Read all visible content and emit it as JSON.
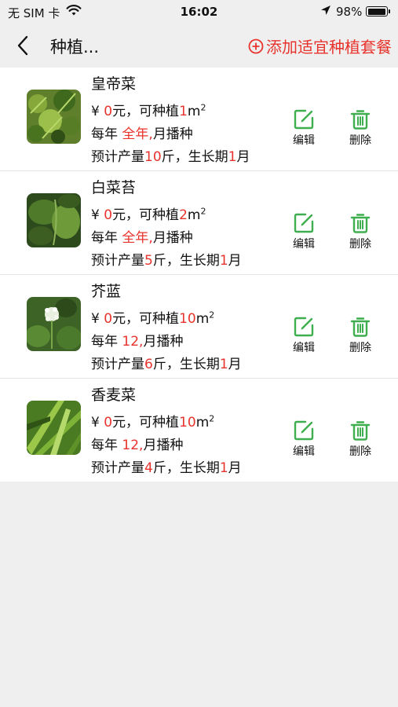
{
  "status": {
    "carrier": "无 SIM 卡",
    "time": "16:02",
    "battery_pct": "98%",
    "battery_level": 0.98
  },
  "nav": {
    "title": "种植...",
    "add_label": "添加适宜种植套餐"
  },
  "labels": {
    "currency": "¥",
    "yuan_plant": "元，可种植",
    "unit_m": "m",
    "sq": "2",
    "yearly": "每年",
    "month_sow": "月播种",
    "est_yield": "预计产量",
    "jin_period": "斤，生长期",
    "month": "月",
    "edit": "编辑",
    "delete": "删除"
  },
  "items": [
    {
      "name": "皇帝菜",
      "price": "0",
      "area": "1",
      "season": "全年,",
      "yield": "10",
      "period": "1"
    },
    {
      "name": "白菜苔",
      "price": "0",
      "area": "2",
      "season": "全年,",
      "yield": "5",
      "period": "1"
    },
    {
      "name": "芥蓝",
      "price": "0",
      "area": "10",
      "season": "12,",
      "yield": "6",
      "period": "1"
    },
    {
      "name": "香麦菜",
      "price": "0",
      "area": "10",
      "season": "12,",
      "yield": "4",
      "period": "1"
    }
  ],
  "colors": {
    "accent_red": "#e8332c",
    "action_green": "#3fae4e"
  }
}
